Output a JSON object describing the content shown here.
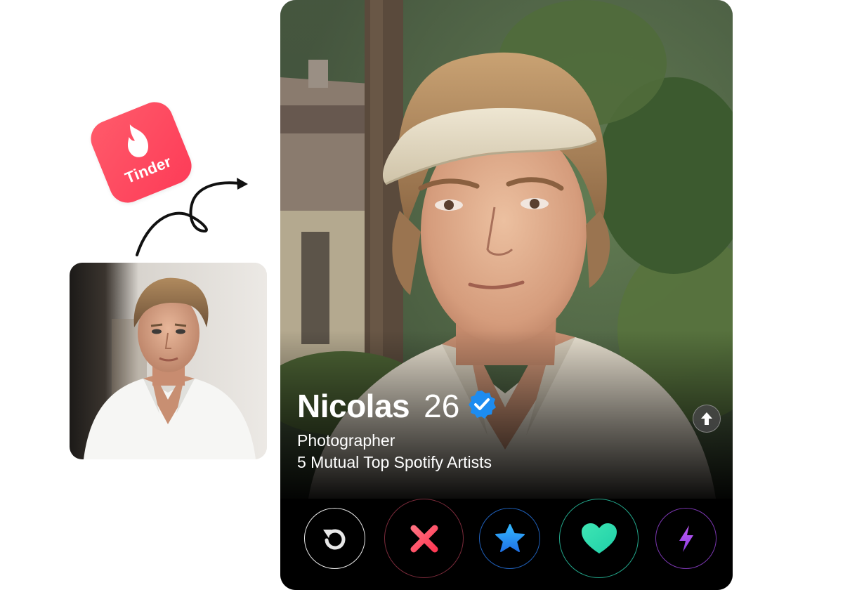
{
  "logo": {
    "wordmark": "Tinder",
    "brand_color": "#fd3c58"
  },
  "profile": {
    "name": "Nicolas",
    "age": "26",
    "job": "Photographer",
    "mutual": "5 Mutual Top Spotify Artists",
    "verified": true
  },
  "icons": {
    "flame": "flame-icon",
    "verified": "verified-badge-icon",
    "expand": "arrow-up-icon",
    "rewind": "rewind-icon",
    "nope": "close-x-icon",
    "super_like": "star-icon",
    "like": "heart-icon",
    "boost": "lightning-bolt-icon"
  },
  "colors": {
    "rewind": "#e8e8e8",
    "nope": "#ff4458",
    "super_like": "#2f8df0",
    "like": "#2de0b0",
    "boost": "#a445e8",
    "verified": "#1d8cf0"
  }
}
